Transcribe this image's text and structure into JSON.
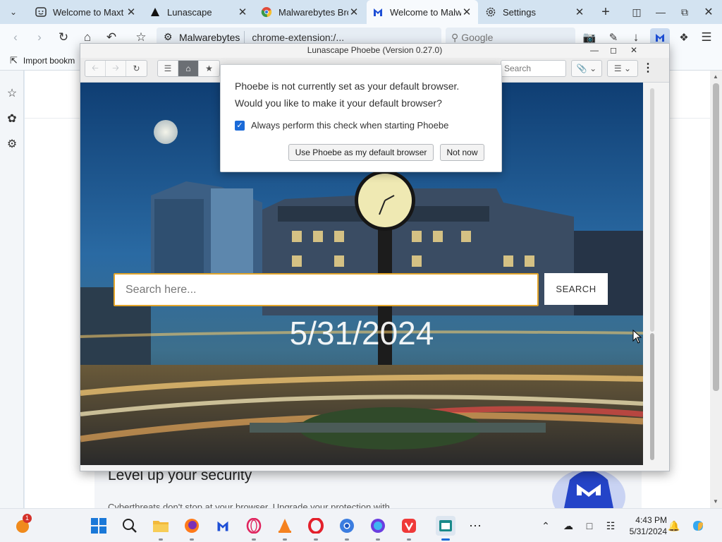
{
  "browser": {
    "tabs": [
      {
        "label": "Welcome to Maxt",
        "icon": "maxthon-icon",
        "active": false
      },
      {
        "label": "Lunascape",
        "icon": "lunascape-icon",
        "active": false
      },
      {
        "label": "Malwarebytes Bro",
        "icon": "chrome-icon",
        "active": false
      },
      {
        "label": "Welcome to Malw",
        "icon": "malwarebytes-icon",
        "active": true
      },
      {
        "label": "Settings",
        "icon": "gear-icon",
        "active": false
      }
    ],
    "url_site": "Malwarebytes",
    "url_path": "chrome-extension:/...",
    "search_placeholder": "Google",
    "bookmark_import": "Import bookm",
    "page_heading": "Level up your security",
    "page_text": "Cyberthreats don't stop at your browser. Upgrade your protection with"
  },
  "lunascape": {
    "title": "Lunascape Phoebe (Version 0.27.0)",
    "toolbar_search_placeholder": "Search",
    "search_placeholder": "Search here...",
    "search_button": "SEARCH",
    "date": "5/31/2024"
  },
  "dialog": {
    "line1": "Phoebe is not currently set as your default browser.",
    "line2": "Would you like to make it your default browser?",
    "checkbox_label": "Always perform this check when starting Phoebe",
    "checkbox_checked": true,
    "primary_button": "Use Phoebe as my default browser",
    "secondary_button": "Not now"
  },
  "taskbar": {
    "notification_count": "1",
    "time": "4:43 PM",
    "date": "5/31/2024",
    "apps": [
      "start",
      "search",
      "file-explorer",
      "firefox",
      "malwarebytes",
      "opera-gx",
      "vlc",
      "opera",
      "chromium",
      "edge-like",
      "vivaldi",
      "lunascape",
      "more"
    ]
  },
  "colors": {
    "accent_blue": "#1a6ad8",
    "search_border": "#e2a52b",
    "tabbar": "#d3e3f1"
  }
}
